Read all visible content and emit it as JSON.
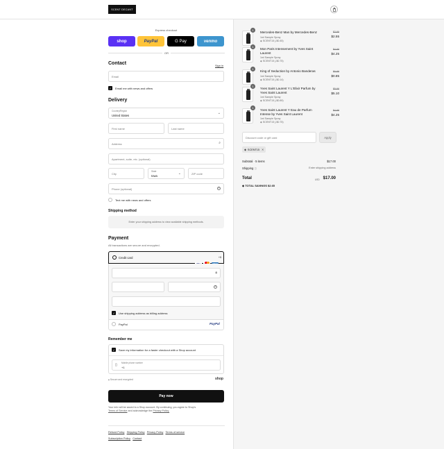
{
  "header": {
    "logo_text": "SCENT DECANT",
    "bag_icon": "bag-icon"
  },
  "express": {
    "label": "Express checkout",
    "buttons": [
      {
        "label": "shop",
        "color": "#5a31f4"
      },
      {
        "label": "PayPal",
        "color": "#ffc439"
      },
      {
        "label": "G Pay",
        "color": "#000000"
      },
      {
        "label": "venmo",
        "color": "#3d95ce"
      }
    ],
    "or": "OR"
  },
  "contact": {
    "title": "Contact",
    "signin": "Sign in",
    "email_placeholder": "Email",
    "email_news": "Email me with news and offers"
  },
  "delivery": {
    "title": "Delivery",
    "country_label": "Country/Region",
    "country_value": "United States",
    "first_name": "First name",
    "last_name": "Last name",
    "address": "Address",
    "apartment": "Apartment, suite, etc. (optional)",
    "city": "City",
    "state_label": "State",
    "state_value": "Iowa",
    "zip": "ZIP code",
    "phone": "Phone (optional)",
    "text_news": "Text me with news and offers"
  },
  "shipping_method": {
    "title": "Shipping method",
    "message": "Enter your shipping address to view available shipping methods."
  },
  "payment": {
    "title": "Payment",
    "subtitle": "All transactions are secure and encrypted.",
    "credit_card": "Credit card",
    "more_cards": "+5",
    "billing_same": "Use shipping address as billing address",
    "paypal": "PayPal",
    "paypal_logo": "PayPal"
  },
  "remember": {
    "title": "Remember me",
    "save_info": "Save my information for a faster checkout with a Shop account",
    "mobile_label": "Mobile phone number",
    "mobile_value": "+1",
    "secure": "Secure and encrypted",
    "shop": "shop"
  },
  "pay": {
    "button": "Pay now",
    "terms_1": "Your info will be saved to a Shop account. By continuing, you agree to Shop's",
    "terms_link": "Terms of Service",
    "terms_2": "and acknowledge the",
    "privacy_link": "Privacy Policy."
  },
  "footer": [
    "Refund Policy",
    "Shipping Policy",
    "Privacy Policy",
    "Terms of service",
    "Subscription Policy",
    "Contact"
  ],
  "order": {
    "items": [
      {
        "qty": "1",
        "name": "Mercedes-Benz Man by Mercedes-Benz",
        "variant": "1ml Sample Spray",
        "discount": "SCENT15 (-$0.45)",
        "compare": "$2.99",
        "price": "$2.55"
      },
      {
        "qty": "1",
        "name": "Mon Paris Intensement by Yves Saint Laurent",
        "variant": "1ml Sample Spray",
        "discount": "SCENT15 (-$0.75)",
        "compare": "$4.99",
        "price": "$4.25"
      },
      {
        "qty": "1",
        "name": "King of Seduction by Antonio Banderas",
        "variant": "1ml Sample Spray",
        "discount": "SCENT15 (-$0.14)",
        "compare": "$0.99",
        "price": "$0.85"
      },
      {
        "qty": "1",
        "name": "Yves Saint Laurent Y L'Elixir Parfum by Yves Saint Laurent",
        "variant": "1ml Sample Spray",
        "discount": "SCENT15 (-$0.89)",
        "compare": "$5.99",
        "price": "$5.10"
      },
      {
        "qty": "1",
        "name": "Yves Saint Laurent Y Eau de Parfum Intense by Yves Saint Laurent",
        "variant": "1ml Sample Spray",
        "discount": "SCENT15 (-$0.75)",
        "compare": "$4.99",
        "price": "$4.25"
      }
    ],
    "discount_placeholder": "Discount code or gift card",
    "apply": "Apply",
    "code": "SCENT15",
    "subtotal_label": "Subtotal · 5 items",
    "subtotal_value": "$17.00",
    "shipping_label": "Shipping",
    "shipping_value": "Enter shipping address",
    "total_label": "Total",
    "currency": "USD",
    "total_value": "$17.00",
    "savings": "TOTAL SAVINGS  $2.65"
  }
}
